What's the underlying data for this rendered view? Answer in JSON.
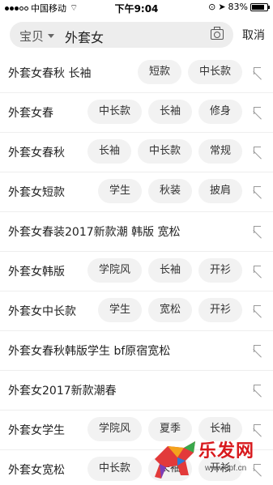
{
  "status_bar": {
    "carrier": "中国移动",
    "time": "下午9:04",
    "battery": "83%"
  },
  "search": {
    "scope": "宝贝",
    "query": "外套女",
    "cancel_label": "取消"
  },
  "suggestions": [
    {
      "label": "外套女春秋 长袖",
      "tags": [
        "短款",
        "中长款"
      ]
    },
    {
      "label": "外套女春",
      "tags": [
        "中长款",
        "长袖",
        "修身"
      ]
    },
    {
      "label": "外套女春秋",
      "tags": [
        "长袖",
        "中长款",
        "常规"
      ]
    },
    {
      "label": "外套女短款",
      "tags": [
        "学生",
        "秋装",
        "披肩"
      ]
    },
    {
      "label": "外套女春装2017新款潮 韩版 宽松",
      "tags": []
    },
    {
      "label": "外套女韩版",
      "tags": [
        "学院风",
        "长袖",
        "开衫"
      ]
    },
    {
      "label": "外套女中长款",
      "tags": [
        "学生",
        "宽松",
        "开衫"
      ]
    },
    {
      "label": "外套女春秋韩版学生 bf原宿宽松",
      "tags": []
    },
    {
      "label": "外套女2017新款潮春",
      "tags": []
    },
    {
      "label": "外套女学生",
      "tags": [
        "学院风",
        "夏季",
        "长袖"
      ]
    },
    {
      "label": "外套女宽松",
      "tags": [
        "中长款",
        "长袖",
        "开衫"
      ]
    }
  ],
  "watermark": {
    "name": "乐发网",
    "url": "www.6pf.cn"
  }
}
